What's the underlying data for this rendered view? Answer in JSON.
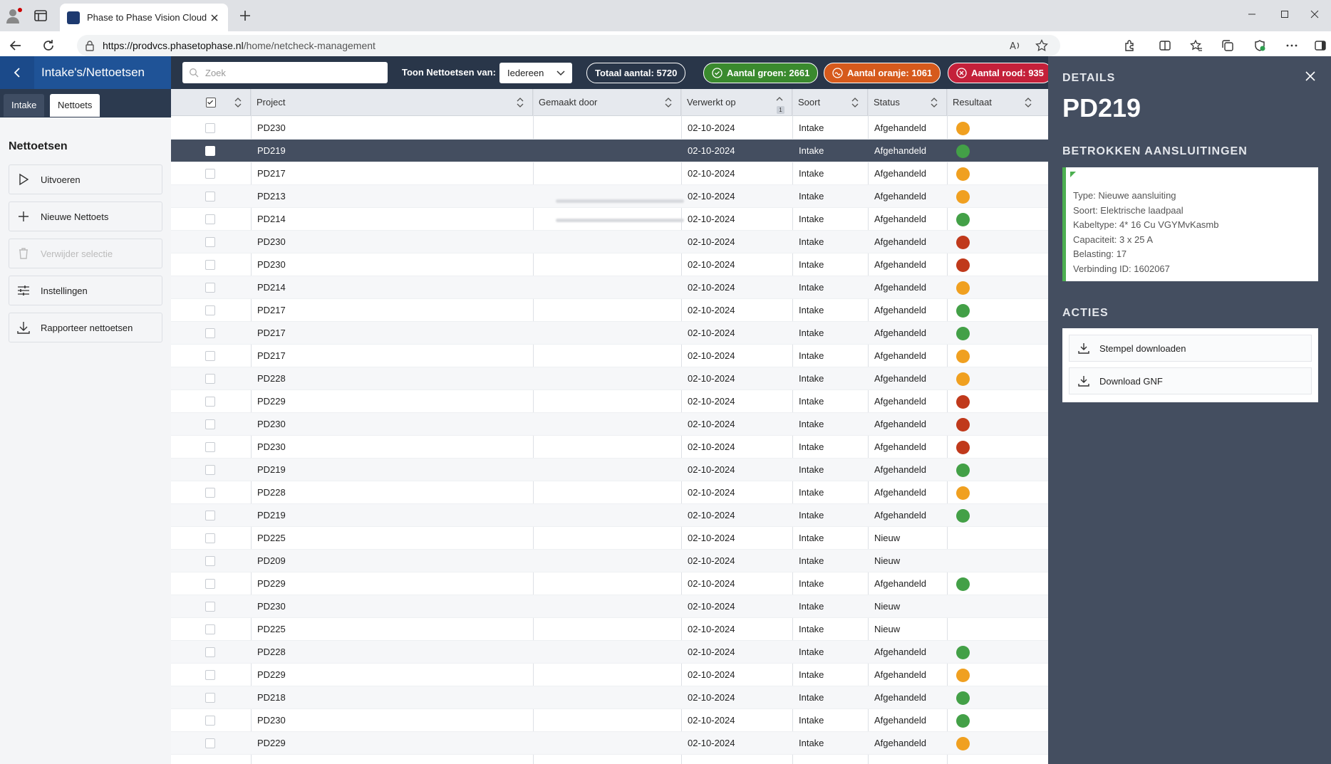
{
  "browser": {
    "tab_title": "Phase to Phase Vision Cloud",
    "url_host": "https://prodvcs.phasetophase.nl",
    "url_path": "/home/netcheck-management"
  },
  "sidebar": {
    "title": "Intake's/Nettoetsen",
    "tabs": [
      {
        "label": "Intake"
      },
      {
        "label": "Nettoets"
      }
    ],
    "section_title": "Nettoetsen",
    "buttons": [
      {
        "label": "Uitvoeren",
        "icon": "play-icon"
      },
      {
        "label": "Nieuwe Nettoets",
        "icon": "plus-icon"
      },
      {
        "label": "Verwijder selectie",
        "icon": "trash-icon"
      },
      {
        "label": "Instellingen",
        "icon": "sliders-icon"
      },
      {
        "label": "Rapporteer nettoetsen",
        "icon": "download-icon"
      }
    ]
  },
  "toolbar": {
    "search_placeholder": "Zoek",
    "show_label": "Toon Nettoetsen van:",
    "show_value": "Iedereen",
    "total_label": "Totaal aantal:",
    "total_value": "5720",
    "green_label": "Aantal groen:",
    "green_value": "2661",
    "orange_label": "Aantal oranje:",
    "orange_value": "1061",
    "red_label": "Aantal rood:",
    "red_value": "935"
  },
  "colors": {
    "green": "#43a047",
    "orange": "#f0a020",
    "red": "#c0391b",
    "selected_row": "#444e60",
    "header_blue": "#1f5397"
  },
  "table": {
    "columns": [
      "Project",
      "Gemaakt door",
      "Verwerkt op",
      "Soort",
      "Status",
      "Resultaat"
    ],
    "sort_index": "1",
    "rows": [
      {
        "project": "PD230",
        "date": "02-10-2024",
        "type": "Intake",
        "status": "Afgehandeld",
        "result": "orange"
      },
      {
        "project": "PD219",
        "date": "02-10-2024",
        "type": "Intake",
        "status": "Afgehandeld",
        "result": "green",
        "selected": true
      },
      {
        "project": "PD217",
        "date": "02-10-2024",
        "type": "Intake",
        "status": "Afgehandeld",
        "result": "orange"
      },
      {
        "project": "PD213",
        "date": "02-10-2024",
        "type": "Intake",
        "status": "Afgehandeld",
        "result": "orange"
      },
      {
        "project": "PD214",
        "date": "02-10-2024",
        "type": "Intake",
        "status": "Afgehandeld",
        "result": "green"
      },
      {
        "project": "PD230",
        "date": "02-10-2024",
        "type": "Intake",
        "status": "Afgehandeld",
        "result": "red"
      },
      {
        "project": "PD230",
        "date": "02-10-2024",
        "type": "Intake",
        "status": "Afgehandeld",
        "result": "red"
      },
      {
        "project": "PD214",
        "date": "02-10-2024",
        "type": "Intake",
        "status": "Afgehandeld",
        "result": "orange"
      },
      {
        "project": "PD217",
        "date": "02-10-2024",
        "type": "Intake",
        "status": "Afgehandeld",
        "result": "green"
      },
      {
        "project": "PD217",
        "date": "02-10-2024",
        "type": "Intake",
        "status": "Afgehandeld",
        "result": "green"
      },
      {
        "project": "PD217",
        "date": "02-10-2024",
        "type": "Intake",
        "status": "Afgehandeld",
        "result": "orange"
      },
      {
        "project": "PD228",
        "date": "02-10-2024",
        "type": "Intake",
        "status": "Afgehandeld",
        "result": "orange"
      },
      {
        "project": "PD229",
        "date": "02-10-2024",
        "type": "Intake",
        "status": "Afgehandeld",
        "result": "red"
      },
      {
        "project": "PD230",
        "date": "02-10-2024",
        "type": "Intake",
        "status": "Afgehandeld",
        "result": "red"
      },
      {
        "project": "PD230",
        "date": "02-10-2024",
        "type": "Intake",
        "status": "Afgehandeld",
        "result": "red"
      },
      {
        "project": "PD219",
        "date": "02-10-2024",
        "type": "Intake",
        "status": "Afgehandeld",
        "result": "green"
      },
      {
        "project": "PD228",
        "date": "02-10-2024",
        "type": "Intake",
        "status": "Afgehandeld",
        "result": "orange"
      },
      {
        "project": "PD219",
        "date": "02-10-2024",
        "type": "Intake",
        "status": "Afgehandeld",
        "result": "green"
      },
      {
        "project": "PD225",
        "date": "02-10-2024",
        "type": "Intake",
        "status": "Nieuw",
        "result": ""
      },
      {
        "project": "PD209",
        "date": "02-10-2024",
        "type": "Intake",
        "status": "Nieuw",
        "result": ""
      },
      {
        "project": "PD229",
        "date": "02-10-2024",
        "type": "Intake",
        "status": "Afgehandeld",
        "result": "green"
      },
      {
        "project": "PD230",
        "date": "02-10-2024",
        "type": "Intake",
        "status": "Nieuw",
        "result": ""
      },
      {
        "project": "PD225",
        "date": "02-10-2024",
        "type": "Intake",
        "status": "Nieuw",
        "result": ""
      },
      {
        "project": "PD228",
        "date": "02-10-2024",
        "type": "Intake",
        "status": "Afgehandeld",
        "result": "green"
      },
      {
        "project": "PD229",
        "date": "02-10-2024",
        "type": "Intake",
        "status": "Afgehandeld",
        "result": "orange"
      },
      {
        "project": "PD218",
        "date": "02-10-2024",
        "type": "Intake",
        "status": "Afgehandeld",
        "result": "green"
      },
      {
        "project": "PD230",
        "date": "02-10-2024",
        "type": "Intake",
        "status": "Afgehandeld",
        "result": "green"
      },
      {
        "project": "PD229",
        "date": "02-10-2024",
        "type": "Intake",
        "status": "Afgehandeld",
        "result": "orange"
      }
    ]
  },
  "details": {
    "label": "DETAILS",
    "title": "PD219",
    "connections_label": "BETROKKEN AANSLUITINGEN",
    "connection_lines": [
      "Type: Nieuwe aansluiting",
      "Soort: Elektrische laadpaal",
      "Kabeltype: 4* 16 Cu VGYMvKasmb",
      "Capaciteit: 3 x 25 A",
      "Belasting: 17",
      "Verbinding ID: 1602067"
    ],
    "actions_label": "ACTIES",
    "actions": [
      {
        "label": "Stempel downloaden"
      },
      {
        "label": "Download GNF"
      }
    ]
  }
}
